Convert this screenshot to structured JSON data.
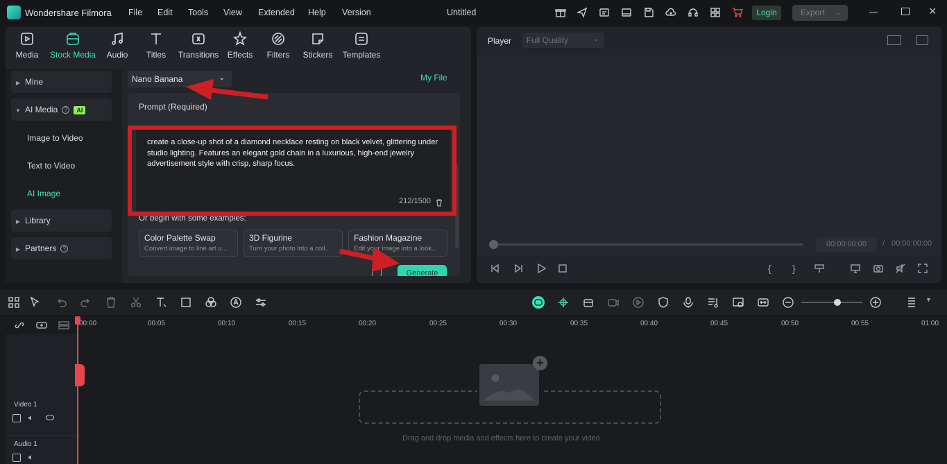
{
  "app": {
    "name": "Wondershare Filmora",
    "document_title": "Untitled",
    "menu": [
      "File",
      "Edit",
      "Tools",
      "View",
      "Extended",
      "Help",
      "Version"
    ],
    "login_label": "Login",
    "export_label": "Export"
  },
  "media_tabs": [
    "Media",
    "Stock Media",
    "Audio",
    "Titles",
    "Transitions",
    "Effects",
    "Filters",
    "Stickers",
    "Templates"
  ],
  "active_tab": "Stock Media",
  "sidebar": {
    "mine": "Mine",
    "ai_media": "AI Media",
    "ai_badge": "AI",
    "image_to_video": "Image to Video",
    "text_to_video": "Text to Video",
    "ai_image": "AI Image",
    "library": "Library",
    "partners": "Partners"
  },
  "ai_image": {
    "model": "Nano Banana",
    "my_file": "My File",
    "prompt_label": "Prompt (Required)",
    "prompt_text": "create a close-up shot of a diamond necklace resting on black velvet, glittering under studio lighting. Features an elegant gold chain in a luxurious, high-end jewelry advertisement style with crisp, sharp focus.",
    "char_count": "212/1500",
    "examples_label": "Or begin with some examples:",
    "examples": [
      {
        "title": "Color Palette Swap",
        "desc": "Convert image to line art u..."
      },
      {
        "title": "3D Figurine",
        "desc": "Turn your photo into a coll..."
      },
      {
        "title": "Fashion Magazine",
        "desc": "Edit your image into a look..."
      }
    ],
    "generate_label": "Generate"
  },
  "player": {
    "label": "Player",
    "quality": "Full Quality",
    "time_current": "00:00:00:00",
    "time_sep": "/",
    "time_total": "00:00:00:00"
  },
  "timeline": {
    "ticks": [
      "00:00",
      "00:05",
      "00:10",
      "00:15",
      "00:20",
      "00:25",
      "00:30",
      "00:35",
      "00:40",
      "00:45",
      "00:50",
      "00:55",
      "01:00"
    ],
    "video_track": "Video 1",
    "audio_track": "Audio 1",
    "drop_hint": "Drag and drop media and effects here to create your video."
  },
  "colors": {
    "accent": "#3ee0b6",
    "annotation_red": "#d01e25",
    "playhead": "#e8464d"
  }
}
